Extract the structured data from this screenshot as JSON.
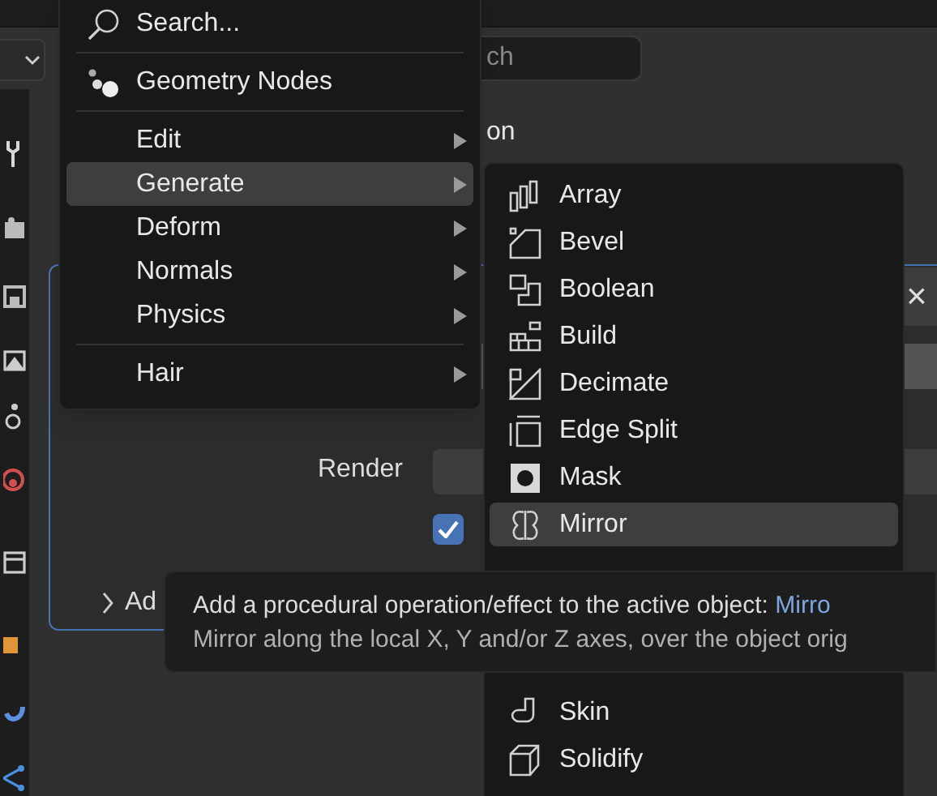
{
  "properties_editor": {
    "search_field": {
      "value": "ch"
    },
    "heading": "on",
    "render_label": "Render",
    "checkbox": {
      "checked": true
    },
    "panel_close": "×",
    "add_section": {
      "label": "Ad",
      "expanded": false
    }
  },
  "add_menu": {
    "items": [
      {
        "kind": "search",
        "label": "Search...",
        "submenu": false,
        "selected": false
      },
      {
        "kind": "separator"
      },
      {
        "kind": "nodes",
        "label": "Geometry Nodes",
        "submenu": false,
        "selected": false
      },
      {
        "kind": "separator"
      },
      {
        "kind": "plain",
        "label": "Edit",
        "submenu": true,
        "selected": false
      },
      {
        "kind": "plain",
        "label": "Generate",
        "submenu": true,
        "selected": true
      },
      {
        "kind": "plain",
        "label": "Deform",
        "submenu": true,
        "selected": false
      },
      {
        "kind": "plain",
        "label": "Normals",
        "submenu": true,
        "selected": false
      },
      {
        "kind": "plain",
        "label": "Physics",
        "submenu": true,
        "selected": false
      },
      {
        "kind": "separator"
      },
      {
        "kind": "plain",
        "label": "Hair",
        "submenu": true,
        "selected": false
      }
    ]
  },
  "generate_menu": {
    "items": [
      {
        "label": "Array",
        "selected": false
      },
      {
        "label": "Bevel",
        "selected": false
      },
      {
        "label": "Boolean",
        "selected": false
      },
      {
        "label": "Build",
        "selected": false
      },
      {
        "label": "Decimate",
        "selected": false
      },
      {
        "label": "Edge Split",
        "selected": false
      },
      {
        "label": "Mask",
        "selected": false
      },
      {
        "label": "Mirror",
        "selected": true
      },
      {
        "label": "Skin",
        "selected": false
      },
      {
        "label": "Solidify",
        "selected": false
      }
    ]
  },
  "tooltip": {
    "description": "Add a procedural operation/effect to the active object: ",
    "operator": "Mirro",
    "detail": "Mirror along the local X, Y and/or Z axes, over the object orig"
  }
}
